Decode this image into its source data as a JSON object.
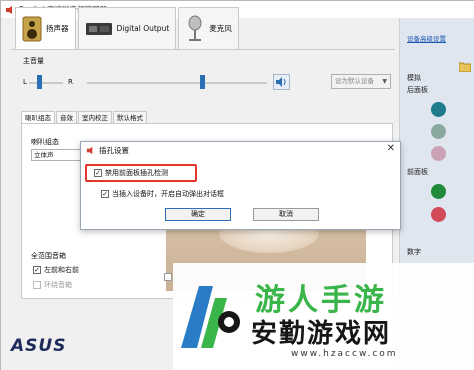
{
  "window": {
    "title": "Realtek高清晰音频管理器"
  },
  "device_tabs": [
    {
      "label": "扬声器",
      "icon": "speaker-icon",
      "active": true
    },
    {
      "label": "Digital Output",
      "icon": "digital-output-icon",
      "active": false
    },
    {
      "label": "麦克风",
      "icon": "microphone-icon",
      "active": false
    }
  ],
  "main_volume": {
    "label": "主音量",
    "left_label": "L",
    "right_label": "R",
    "balance": 0.25,
    "level": 0.64,
    "default_device_label": "设为默认设备"
  },
  "sub_tabs": [
    "喇叭组态",
    "音效",
    "室内校正",
    "默认格式"
  ],
  "speaker_config": {
    "label": "喇叭组态",
    "value": "立体声"
  },
  "full_range": {
    "label": "全范围音箱",
    "options": [
      {
        "label": "左前和右前",
        "checked": true,
        "enabled": true
      },
      {
        "label": "环绕音箱",
        "checked": false,
        "enabled": false
      }
    ]
  },
  "right_pane": {
    "advanced_link": "设备高级设置",
    "analog_label": "模拟",
    "rear_panel_label": "后面板",
    "front_panel_label": "前面板",
    "digital_label": "数字",
    "jacks_rear": [
      "#1f7a8c",
      "#8aa89e",
      "#c9a3b5"
    ],
    "jacks_front": [
      "#1e8a3a",
      "#d24a5a"
    ]
  },
  "dialog": {
    "title": "插孔设置",
    "close_glyph": "✕",
    "option_disable_front": "禁用前面板插孔检测",
    "option_popup": "当插入设备时，开启自动弹出对话框",
    "ok": "确定",
    "cancel": "取消"
  },
  "branding": {
    "logo": "ASUS"
  },
  "watermark": {
    "line1": "游人手游",
    "line2": "安勤游戏网",
    "url": "www.hzaccw.com"
  },
  "colors": {
    "accent": "#2b6fb5",
    "highlight": "#e0362b",
    "watermark_green": "#39b54a"
  }
}
